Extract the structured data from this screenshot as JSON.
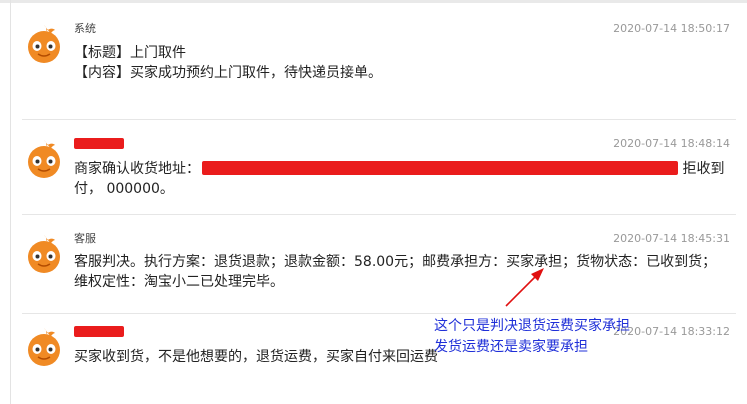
{
  "messages": [
    {
      "sender": "系统",
      "time": "2020-07-14 18:50:17",
      "lines": [
        "【标题】上门取件",
        "【内容】买家成功预约上门取件，待快递员接单。"
      ]
    },
    {
      "sender": "",
      "sender_redacted": true,
      "time": "2020-07-14 18:48:14",
      "line1_prefix": "商家确认收货地址：",
      "line1_suffix": "拒收到",
      "line2": "付， 000000。"
    },
    {
      "sender": "客服",
      "time": "2020-07-14 18:45:31",
      "lines": [
        "客服判决。执行方案：退货退款；退款金额：58.00元；邮费承担方：买家承担；货物状态：已收到货；",
        "维权定性：淘宝小二已处理完毕。"
      ]
    },
    {
      "sender": "",
      "sender_redacted": true,
      "time": "2020-07-14 18:33:12",
      "lines": [
        "买家收到货，不是他想要的，退货运费，买家自付来回运费"
      ]
    }
  ],
  "annotation": {
    "lines": [
      "这个只是判决退货运费买家承担",
      "发货运费还是卖家要承担"
    ],
    "color": "#1f2fd8"
  },
  "colors": {
    "redaction": "#ea1c1c",
    "avatar": "#f08a24"
  },
  "icons": {
    "avatar": "orange-mascot-avatar-icon",
    "arrow": "red-arrow-icon"
  }
}
